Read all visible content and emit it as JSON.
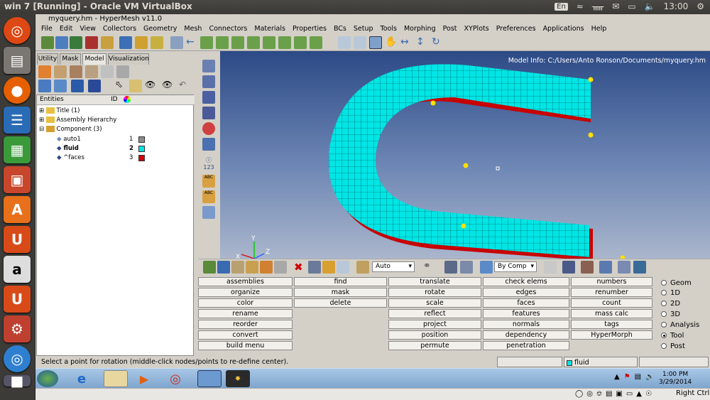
{
  "os_bar": {
    "title": "win 7 [Running] - Oracle VM VirtualBox",
    "lang": "En",
    "time": "13:00"
  },
  "window": {
    "title": "myquery.hm - HyperMesh v11.0"
  },
  "menu": [
    "File",
    "Edit",
    "View",
    "Collectors",
    "Geometry",
    "Mesh",
    "Connectors",
    "Materials",
    "Properties",
    "BCs",
    "Setup",
    "Tools",
    "Morphing",
    "Post",
    "XYPlots",
    "Preferences",
    "Applications",
    "Help"
  ],
  "tabs": [
    "Utility",
    "Mask",
    "Model",
    "Visualization"
  ],
  "active_tab": "Model",
  "tree": {
    "headers": {
      "entities": "Entities",
      "id": "ID"
    },
    "rows": [
      {
        "label": "Title (1)"
      },
      {
        "label": "Assembly Hierarchy"
      },
      {
        "label": "Component (3)"
      },
      {
        "label": "auto1",
        "id": "1",
        "color": "#8c8c8c"
      },
      {
        "label": "fluid",
        "id": "2",
        "color": "#00e5e5"
      },
      {
        "label": "^faces",
        "id": "3",
        "color": "#d40000"
      }
    ]
  },
  "model_info": "Model Info: C:/Users/Anto Ronson/Documents/myquery.hm",
  "axis": {
    "x": "X",
    "y": "Y",
    "z": "Z"
  },
  "toolbar2": {
    "auto": "Auto",
    "bycomp": "By Comp"
  },
  "panel": {
    "col1": [
      "assemblies",
      "organize",
      "color",
      "rename",
      "reorder",
      "convert",
      "build menu"
    ],
    "col2": [
      "find",
      "mask",
      "delete"
    ],
    "col3": [
      "translate",
      "rotate",
      "scale",
      "reflect",
      "project",
      "position",
      "permute"
    ],
    "col4": [
      "check elems",
      "edges",
      "faces",
      "features",
      "normals",
      "dependency",
      "penetration"
    ],
    "col5": [
      "numbers",
      "renumber",
      "count",
      "mass calc",
      "tags",
      "HyperMorph"
    ]
  },
  "radios": {
    "items": [
      "Geom",
      "1D",
      "2D",
      "3D",
      "Analysis",
      "Tool",
      "Post"
    ],
    "selected": "Tool"
  },
  "status": {
    "message": "Select a point for rotation (middle-click nodes/points to re-define center).",
    "component": "fluid"
  },
  "taskbar": {
    "time": "1:00 PM",
    "date": "3/29/2014"
  },
  "vbox": {
    "hostkey": "Right Ctrl"
  },
  "colors": {
    "mesh": "#00e5e5",
    "faces": "#c80000"
  }
}
